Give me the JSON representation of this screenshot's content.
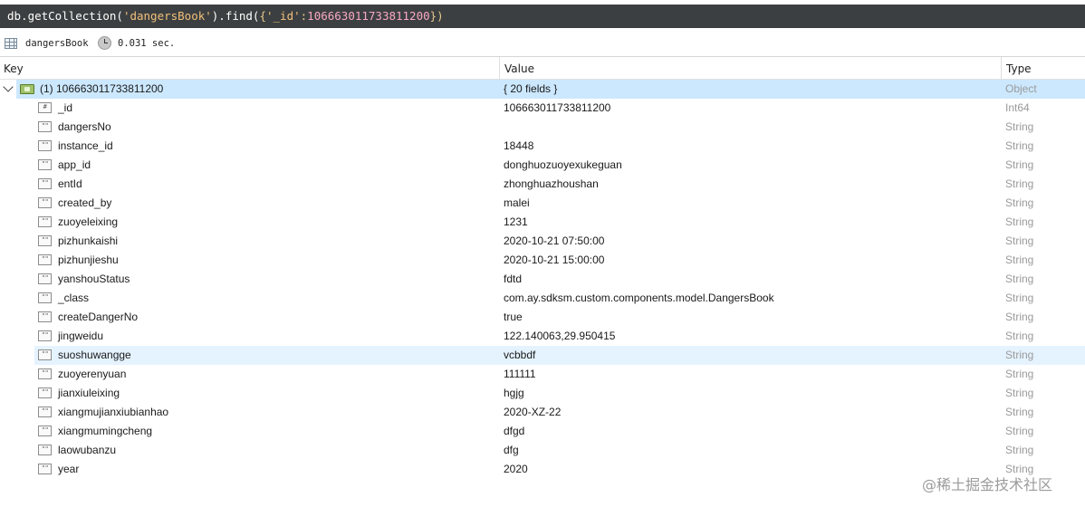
{
  "query": {
    "prefix": "db.getCollection(",
    "collection_arg": "'dangersBook'",
    "mid": ").find(",
    "filter_open": "{",
    "filter_key": "'_id'",
    "filter_colon": ":",
    "filter_value": "106663011733811200",
    "filter_close": "})"
  },
  "info": {
    "collection": "dangersBook",
    "time": "0.031 sec."
  },
  "columns": {
    "key": "Key",
    "value": "Value",
    "type": "Type"
  },
  "document": {
    "key": "(1) 106663011733811200",
    "value": "{ 20 fields }",
    "type": "Object"
  },
  "fields": [
    {
      "icon": "#",
      "key": "_id",
      "value": "106663011733811200",
      "type": "Int64"
    },
    {
      "icon": "\"\"",
      "key": "dangersNo",
      "value": "",
      "type": "String"
    },
    {
      "icon": "\"\"",
      "key": "instance_id",
      "value": "18448",
      "type": "String"
    },
    {
      "icon": "\"\"",
      "key": "app_id",
      "value": "donghuozuoyexukeguan",
      "type": "String"
    },
    {
      "icon": "\"\"",
      "key": "entId",
      "value": "zhonghuazhoushan",
      "type": "String"
    },
    {
      "icon": "\"\"",
      "key": "created_by",
      "value": "malei",
      "type": "String"
    },
    {
      "icon": "\"\"",
      "key": "zuoyeleixing",
      "value": "1231",
      "type": "String"
    },
    {
      "icon": "\"\"",
      "key": "pizhunkaishi",
      "value": "2020-10-21 07:50:00",
      "type": "String"
    },
    {
      "icon": "\"\"",
      "key": "pizhunjieshu",
      "value": "2020-10-21 15:00:00",
      "type": "String"
    },
    {
      "icon": "\"\"",
      "key": "yanshouStatus",
      "value": "fdtd",
      "type": "String"
    },
    {
      "icon": "\"\"",
      "key": "_class",
      "value": "com.ay.sdksm.custom.components.model.DangersBook",
      "type": "String"
    },
    {
      "icon": "\"\"",
      "key": "createDangerNo",
      "value": "true",
      "type": "String"
    },
    {
      "icon": "\"\"",
      "key": "jingweidu",
      "value": "122.140063,29.950415",
      "type": "String"
    },
    {
      "icon": "\"\"",
      "key": "suoshuwangge",
      "value": "vcbbdf",
      "type": "String"
    },
    {
      "icon": "\"\"",
      "key": "zuoyerenyuan",
      "value": "111111",
      "type": "String"
    },
    {
      "icon": "\"\"",
      "key": "jianxiuleixing",
      "value": "hgjg",
      "type": "String"
    },
    {
      "icon": "\"\"",
      "key": "xiangmujianxiubianhao",
      "value": "2020-XZ-22",
      "type": "String"
    },
    {
      "icon": "\"\"",
      "key": "xiangmumingcheng",
      "value": "dfgd",
      "type": "String"
    },
    {
      "icon": "\"\"",
      "key": "laowubanzu",
      "value": "dfg",
      "type": "String"
    },
    {
      "icon": "\"\"",
      "key": "year",
      "value": "2020",
      "type": "String"
    }
  ],
  "watermark": "@稀土掘金技术社区"
}
